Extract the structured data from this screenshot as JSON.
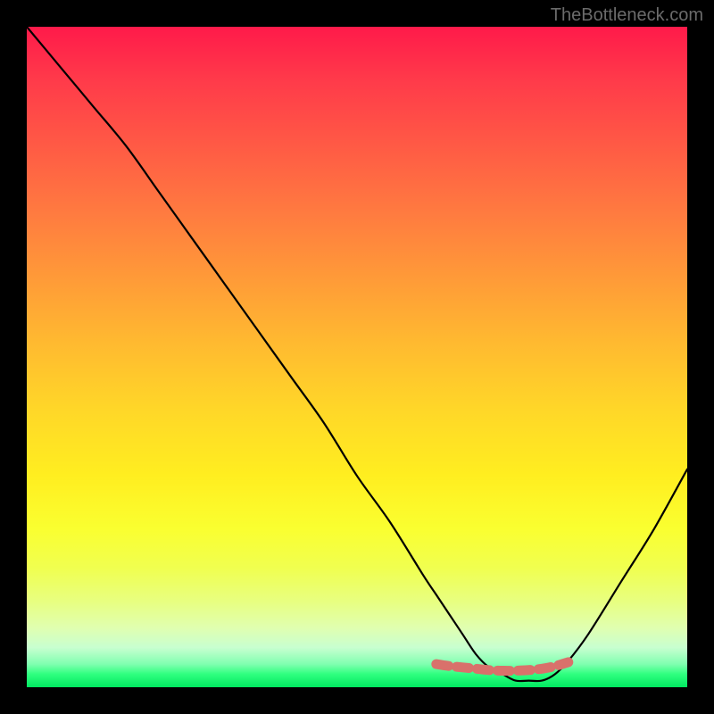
{
  "watermark": "TheBottleneck.com",
  "chart_data": {
    "type": "line",
    "title": "",
    "xlabel": "",
    "ylabel": "",
    "xlim": [
      0,
      100
    ],
    "ylim": [
      0,
      100
    ],
    "series": [
      {
        "name": "bottleneck-curve",
        "x": [
          0,
          5,
          10,
          15,
          20,
          25,
          30,
          35,
          40,
          45,
          50,
          55,
          60,
          62,
          64,
          66,
          68,
          70,
          72,
          74,
          76,
          78,
          80,
          82,
          85,
          90,
          95,
          100
        ],
        "y": [
          100,
          94,
          88,
          82,
          75,
          68,
          61,
          54,
          47,
          40,
          32,
          25,
          17,
          14,
          11,
          8,
          5,
          3,
          2,
          1,
          1,
          1,
          2,
          4,
          8,
          16,
          24,
          33
        ]
      },
      {
        "name": "valley-highlight",
        "x": [
          62,
          64,
          66,
          68,
          70,
          72,
          74,
          76,
          78,
          80,
          82
        ],
        "y": [
          3.5,
          3.2,
          3.0,
          2.8,
          2.6,
          2.5,
          2.5,
          2.6,
          2.8,
          3.2,
          3.8
        ]
      }
    ]
  }
}
